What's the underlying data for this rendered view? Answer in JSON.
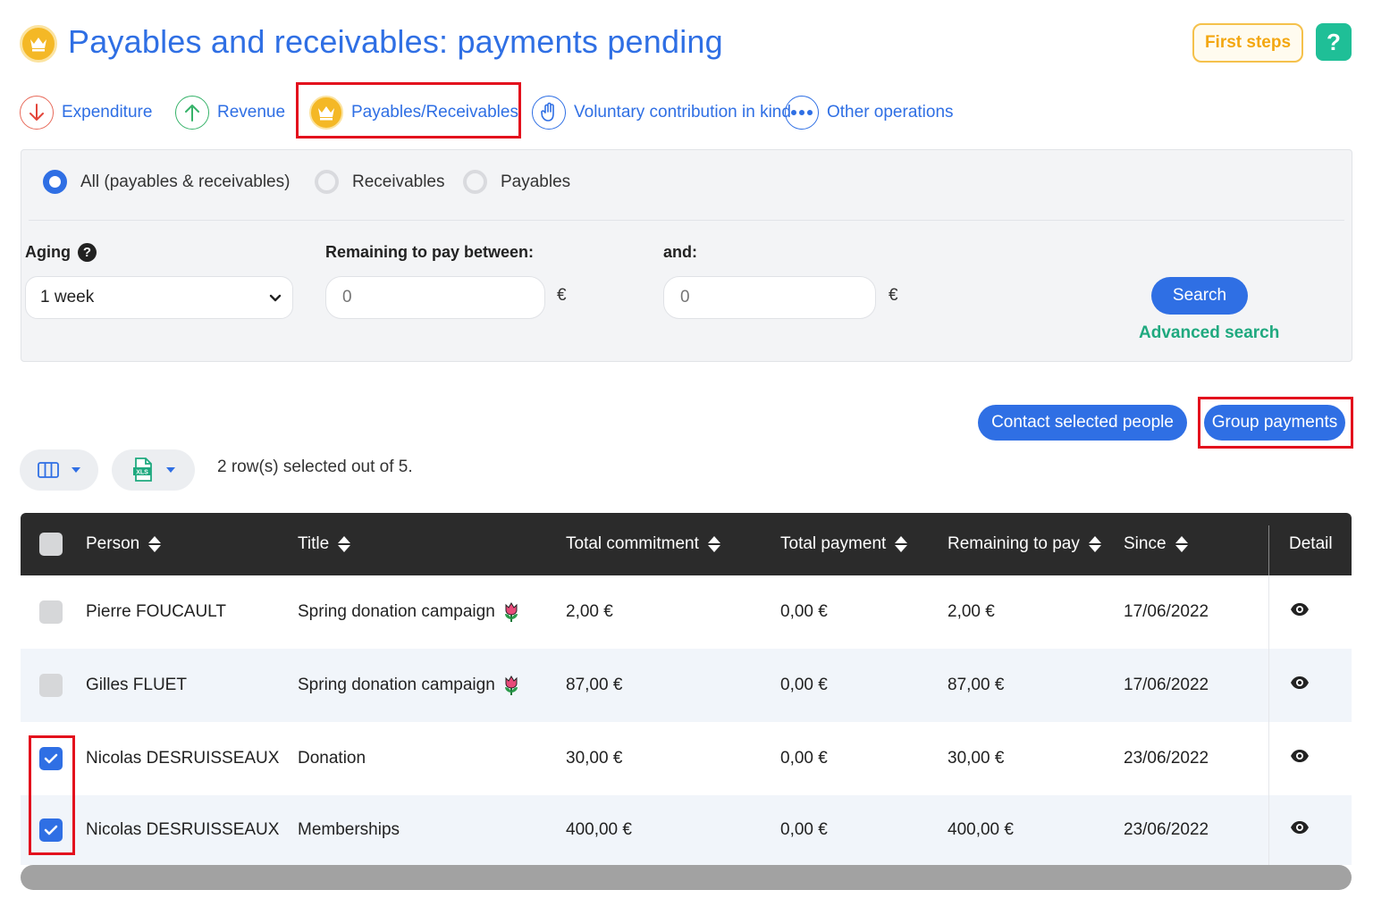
{
  "header": {
    "title": "Payables and receivables: payments pending",
    "first_steps": "First steps",
    "help": "?"
  },
  "tabs": [
    {
      "label": "Expenditure",
      "icon": "arrow-down-icon",
      "color": "#e86a5a"
    },
    {
      "label": "Revenue",
      "icon": "arrow-up-icon",
      "color": "#37b36a"
    },
    {
      "label": "Payables/Receivables",
      "icon": "crown-icon",
      "color": "#f4b826",
      "active": true
    },
    {
      "label": "Voluntary contribution in kind",
      "icon": "hand-icon",
      "color": "#2f6fe4"
    },
    {
      "label": "Other operations",
      "icon": "more-dots-icon",
      "color": "#2f6fe4"
    }
  ],
  "filters": {
    "radios": [
      {
        "label": "All (payables & receivables)",
        "checked": true
      },
      {
        "label": "Receivables",
        "checked": false
      },
      {
        "label": "Payables",
        "checked": false
      }
    ],
    "aging_label": "Aging",
    "aging_value": "1 week",
    "remaining_label": "Remaining to pay between:",
    "remaining_min_placeholder": "0",
    "and_label": "and:",
    "remaining_max_placeholder": "0",
    "currency": "€",
    "search": "Search",
    "advanced_search": "Advanced search"
  },
  "actions": {
    "contact": "Contact selected people",
    "group": "Group payments"
  },
  "selection_info": "2 row(s) selected out of 5.",
  "table": {
    "columns": [
      "Person",
      "Title",
      "Total commitment",
      "Total payment",
      "Remaining to pay",
      "Since",
      "Detail"
    ],
    "rows": [
      {
        "person": "Pierre FOUCAULT",
        "title": "Spring donation campaign",
        "tulip": true,
        "commitment": "2,00 €",
        "payment": "0,00 €",
        "remaining": "2,00 €",
        "since": "17/06/2022",
        "checked": false
      },
      {
        "person": "Gilles FLUET",
        "title": "Spring donation campaign",
        "tulip": true,
        "commitment": "87,00 €",
        "payment": "0,00 €",
        "remaining": "87,00 €",
        "since": "17/06/2022",
        "checked": false
      },
      {
        "person": "Nicolas DESRUISSEAUX",
        "title": "Donation",
        "tulip": false,
        "commitment": "30,00 €",
        "payment": "0,00 €",
        "remaining": "30,00 €",
        "since": "23/06/2022",
        "checked": true
      },
      {
        "person": "Nicolas DESRUISSEAUX",
        "title": "Memberships",
        "tulip": false,
        "commitment": "400,00 €",
        "payment": "0,00 €",
        "remaining": "400,00 €",
        "since": "23/06/2022",
        "checked": true
      }
    ]
  },
  "colors": {
    "primary": "#2f6fe4",
    "accent_green": "#1fa97f",
    "warning_yellow": "#f4b826",
    "highlight_red": "#e3101d",
    "table_header": "#2b2b2b"
  }
}
